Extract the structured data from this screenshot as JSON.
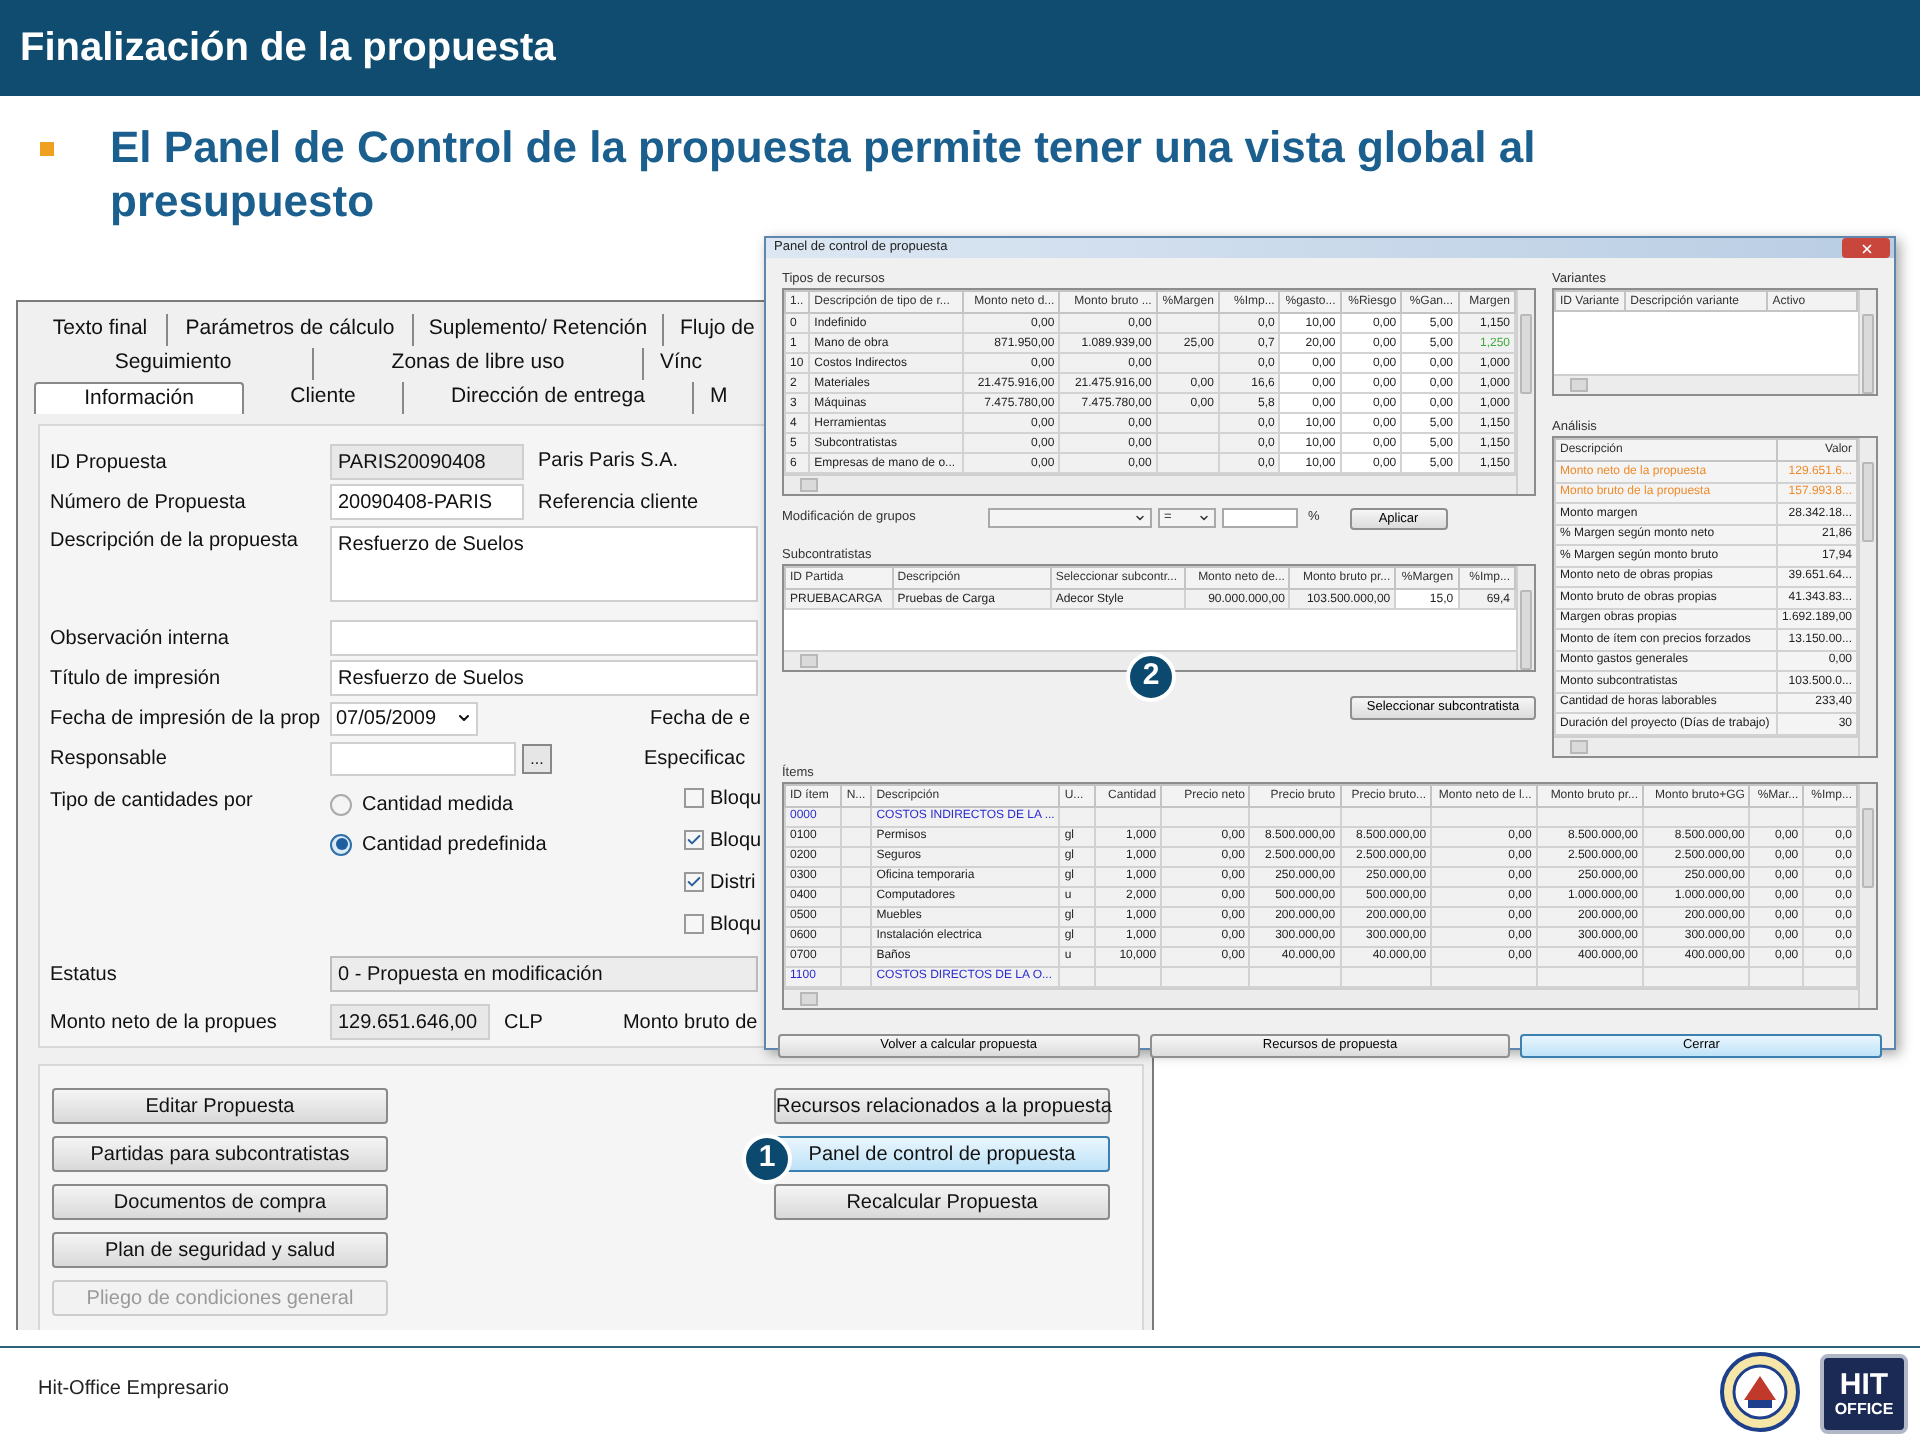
{
  "slide": {
    "title": "Finalización de la propuesta",
    "bullet": "El Panel de Control de la propuesta permite tener una vista global al presupuesto",
    "footer": "Hit-Office Empresario",
    "logo": {
      "line_1": "HIT",
      "line_2": "OFFICE"
    }
  },
  "callouts": [
    "1",
    "2"
  ],
  "proposal_window": {
    "tab_rows": [
      [
        {
          "label": "Texto final",
          "selected": false
        },
        {
          "label": "Parámetros de cálculo",
          "selected": false
        },
        {
          "label": "Suplemento/ Retención",
          "selected": false
        },
        {
          "label": "Flujo de",
          "selected": false
        }
      ],
      [
        {
          "label": "Seguimiento",
          "selected": false
        },
        {
          "label": "Zonas de libre uso",
          "selected": false
        },
        {
          "label": "Vínc",
          "selected": false
        }
      ],
      [
        {
          "label": "Información",
          "selected": true
        },
        {
          "label": "Cliente",
          "selected": false
        },
        {
          "label": "Dirección de entrega",
          "selected": false
        },
        {
          "label": "M",
          "selected": false
        }
      ]
    ],
    "id": {
      "label": "ID Propuesta",
      "value": "PARIS20090408",
      "client": "Paris Paris S.A."
    },
    "number": {
      "label": "Número de Propuesta",
      "value": "20090408-PARIS",
      "aside": "Referencia cliente"
    },
    "description": {
      "label": "Descripción de la propuesta",
      "value": "Resfuerzo de Suelos"
    },
    "internal_note": {
      "label": "Observación interna"
    },
    "print_title": {
      "label": "Título de impresión",
      "value": "Resfuerzo de Suelos"
    },
    "print_date": {
      "label": "Fecha de impresión de la prop",
      "value": "07/05/2009",
      "aside": "Fecha de e"
    },
    "responsible": {
      "label": "Responsable",
      "button": "...",
      "aside": "Especificac"
    },
    "quantity_type": {
      "label": "Tipo de cantidades por",
      "options": [
        {
          "label": "Cantidad medida",
          "selected": false
        },
        {
          "label": "Cantidad predefinida",
          "selected": true
        }
      ]
    },
    "checkboxes": [
      {
        "label": "Bloqu",
        "checked": false
      },
      {
        "label": "Bloqu",
        "checked": true
      },
      {
        "label": "Distri",
        "checked": true
      },
      {
        "label": "Bloqu",
        "checked": false
      }
    ],
    "status": {
      "label": "Estatus",
      "value": "0 - Propuesta en modificación"
    },
    "net_amount": {
      "label": "Monto neto de la propues",
      "value": "129.651.646,00",
      "currency": "CLP",
      "aside": "Monto bruto de"
    },
    "left_buttons": [
      {
        "label": "Editar Propuesta",
        "disabled": false
      },
      {
        "label": "Partidas para subcontratistas",
        "disabled": false
      },
      {
        "label": "Documentos de compra",
        "disabled": false
      },
      {
        "label": "Plan de seguridad y salud",
        "disabled": false
      },
      {
        "label": "Pliego de condiciones general",
        "disabled": true
      }
    ],
    "right_buttons": [
      {
        "label": "Recursos relacionados a la propuesta",
        "selected": false
      },
      {
        "label": "Panel de control de propuesta",
        "selected": true
      },
      {
        "label": "Recalcular Propuesta",
        "selected": false
      }
    ]
  },
  "control_panel": {
    "title": "Panel de control de propuesta",
    "resources": {
      "label": "Tipos de recursos",
      "columns": [
        "1..",
        "Descripción de tipo de r...",
        "Monto neto d...",
        "Monto bruto ...",
        "%Margen",
        "%Imp...",
        "%gasto...",
        "%Riesgo",
        "%Gan...",
        "Margen"
      ],
      "rows": [
        {
          "changed": false,
          "cells": [
            "0",
            "Indefinido",
            "0,00",
            "0,00",
            null,
            "0,0",
            "10,00",
            "0,00",
            "5,00",
            "1,150"
          ]
        },
        {
          "changed": true,
          "cells": [
            "1",
            "Mano de obra",
            "871.950,00",
            "1.089.939,00",
            "25,00",
            "0,7",
            "20,00",
            "0,00",
            "5,00",
            "1,250"
          ]
        },
        {
          "changed": false,
          "cells": [
            "10",
            "Costos Indirectos",
            "0,00",
            "0,00",
            null,
            "0,0",
            "0,00",
            "0,00",
            "0,00",
            "1,000"
          ]
        },
        {
          "changed": false,
          "cells": [
            "2",
            "Materiales",
            "21.475.916,00",
            "21.475.916,00",
            "0,00",
            "16,6",
            "0,00",
            "0,00",
            "0,00",
            "1,000"
          ]
        },
        {
          "changed": false,
          "cells": [
            "3",
            "Máquinas",
            "7.475.780,00",
            "7.475.780,00",
            "0,00",
            "5,8",
            "0,00",
            "0,00",
            "0,00",
            "1,000"
          ]
        },
        {
          "changed": false,
          "cells": [
            "4",
            "Herramientas",
            "0,00",
            "0,00",
            null,
            "0,0",
            "10,00",
            "0,00",
            "5,00",
            "1,150"
          ]
        },
        {
          "changed": false,
          "cells": [
            "5",
            "Subcontratistas",
            "0,00",
            "0,00",
            null,
            "0,0",
            "10,00",
            "0,00",
            "5,00",
            "1,150"
          ]
        },
        {
          "changed": false,
          "cells": [
            "6",
            "Empresas de mano de o...",
            "0,00",
            "0,00",
            null,
            "0,0",
            "10,00",
            "0,00",
            "5,00",
            "1,150"
          ]
        }
      ]
    },
    "group_edit": {
      "label": "Modificación de grupos",
      "operator": "=",
      "unit": "%",
      "button": "Aplicar"
    },
    "subcontractors": {
      "label": "Subcontratistas",
      "columns": [
        "ID Partida",
        "Descripción",
        "Seleccionar subcontr...",
        "Monto neto de...",
        "Monto bruto pr...",
        "%Margen",
        "%Imp..."
      ],
      "rows": [
        {
          "cells": [
            "PRUEBACARGA",
            "Pruebas de Carga",
            "Adecor Style",
            "90.000.000,00",
            "103.500.000,00",
            "15,0",
            "69,4"
          ]
        }
      ],
      "button": "Seleccionar subcontratista"
    },
    "variants": {
      "label": "Variantes",
      "columns": [
        "ID Variante",
        "Descripción variante",
        "Activo"
      ]
    },
    "analysis": {
      "label": "Análisis",
      "columns": [
        "Descripción",
        "Valor"
      ],
      "rows": [
        {
          "highlight": true,
          "cells": [
            "Monto neto de la propuesta",
            "129.651.6..."
          ]
        },
        {
          "highlight": true,
          "cells": [
            "Monto bruto de la propuesta",
            "157.993.8..."
          ]
        },
        {
          "highlight": false,
          "cells": [
            "Monto margen",
            "28.342.18..."
          ]
        },
        {
          "highlight": false,
          "cells": [
            "% Margen según monto neto",
            "21,86"
          ]
        },
        {
          "highlight": false,
          "cells": [
            "% Margen según monto bruto",
            "17,94"
          ]
        },
        {
          "highlight": false,
          "cells": [
            "Monto neto de obras propias",
            "39.651.64..."
          ]
        },
        {
          "highlight": false,
          "cells": [
            "Monto bruto de obras propias",
            "41.343.83..."
          ]
        },
        {
          "highlight": false,
          "cells": [
            "Margen obras propias",
            "1.692.189,00"
          ]
        },
        {
          "highlight": false,
          "cells": [
            "Monto de ítem con precios forzados",
            "13.150.00..."
          ]
        },
        {
          "highlight": false,
          "cells": [
            "Monto gastos generales",
            "0,00"
          ]
        },
        {
          "highlight": false,
          "cells": [
            "Monto subcontratistas",
            "103.500.0..."
          ]
        },
        {
          "highlight": false,
          "cells": [
            "Cantidad de horas laborables",
            "233,40"
          ]
        },
        {
          "highlight": false,
          "cells": [
            "Duración del proyecto (Días de trabajo)",
            "30"
          ]
        }
      ]
    },
    "items": {
      "label": "Ítems",
      "columns": [
        "ID ítem",
        "N...",
        "Descripción",
        "U...",
        "Cantidad",
        "Precio neto",
        "Precio bruto",
        "Precio bruto...",
        "Monto neto de l...",
        "Monto bruto pr...",
        "Monto bruto+GG",
        "%Mar...",
        "%Imp..."
      ],
      "rows": [
        {
          "kind": "group",
          "cells": [
            "0000",
            null,
            "COSTOS INDIRECTOS DE LA ...",
            null,
            null,
            null,
            null,
            null,
            null,
            null,
            null,
            null,
            null
          ]
        },
        {
          "kind": "item",
          "cells": [
            "0100",
            null,
            "Permisos",
            "gl",
            "1,000",
            "0,00",
            "8.500.000,00",
            "8.500.000,00",
            "0,00",
            "8.500.000,00",
            "8.500.000,00",
            "0,00",
            "0,0"
          ]
        },
        {
          "kind": "item",
          "cells": [
            "0200",
            null,
            "Seguros",
            "gl",
            "1,000",
            "0,00",
            "2.500.000,00",
            "2.500.000,00",
            "0,00",
            "2.500.000,00",
            "2.500.000,00",
            "0,00",
            "0,0"
          ]
        },
        {
          "kind": "item",
          "cells": [
            "0300",
            null,
            "Oficina temporaria",
            "gl",
            "1,000",
            "0,00",
            "250.000,00",
            "250.000,00",
            "0,00",
            "250.000,00",
            "250.000,00",
            "0,00",
            "0,0"
          ]
        },
        {
          "kind": "item",
          "cells": [
            "0400",
            null,
            "Computadores",
            "u",
            "2,000",
            "0,00",
            "500.000,00",
            "500.000,00",
            "0,00",
            "1.000.000,00",
            "1.000.000,00",
            "0,00",
            "0,0"
          ]
        },
        {
          "kind": "item",
          "cells": [
            "0500",
            null,
            "Muebles",
            "gl",
            "1,000",
            "0,00",
            "200.000,00",
            "200.000,00",
            "0,00",
            "200.000,00",
            "200.000,00",
            "0,00",
            "0,0"
          ]
        },
        {
          "kind": "item",
          "cells": [
            "0600",
            null,
            "Instalación electrica",
            "gl",
            "1,000",
            "0,00",
            "300.000,00",
            "300.000,00",
            "0,00",
            "300.000,00",
            "300.000,00",
            "0,00",
            "0,0"
          ]
        },
        {
          "kind": "item",
          "cells": [
            "0700",
            null,
            "Baños",
            "u",
            "10,000",
            "0,00",
            "40.000,00",
            "40.000,00",
            "0,00",
            "400.000,00",
            "400.000,00",
            "0,00",
            "0,0"
          ]
        },
        {
          "kind": "group",
          "cells": [
            "1100",
            null,
            "COSTOS DIRECTOS DE LA O...",
            null,
            null,
            null,
            null,
            null,
            null,
            null,
            null,
            null,
            null
          ]
        }
      ]
    },
    "buttons": [
      {
        "label": "Volver a calcular propuesta",
        "focused": false
      },
      {
        "label": "Recursos de propuesta",
        "focused": false
      },
      {
        "label": "Cerrar",
        "focused": true
      }
    ]
  }
}
